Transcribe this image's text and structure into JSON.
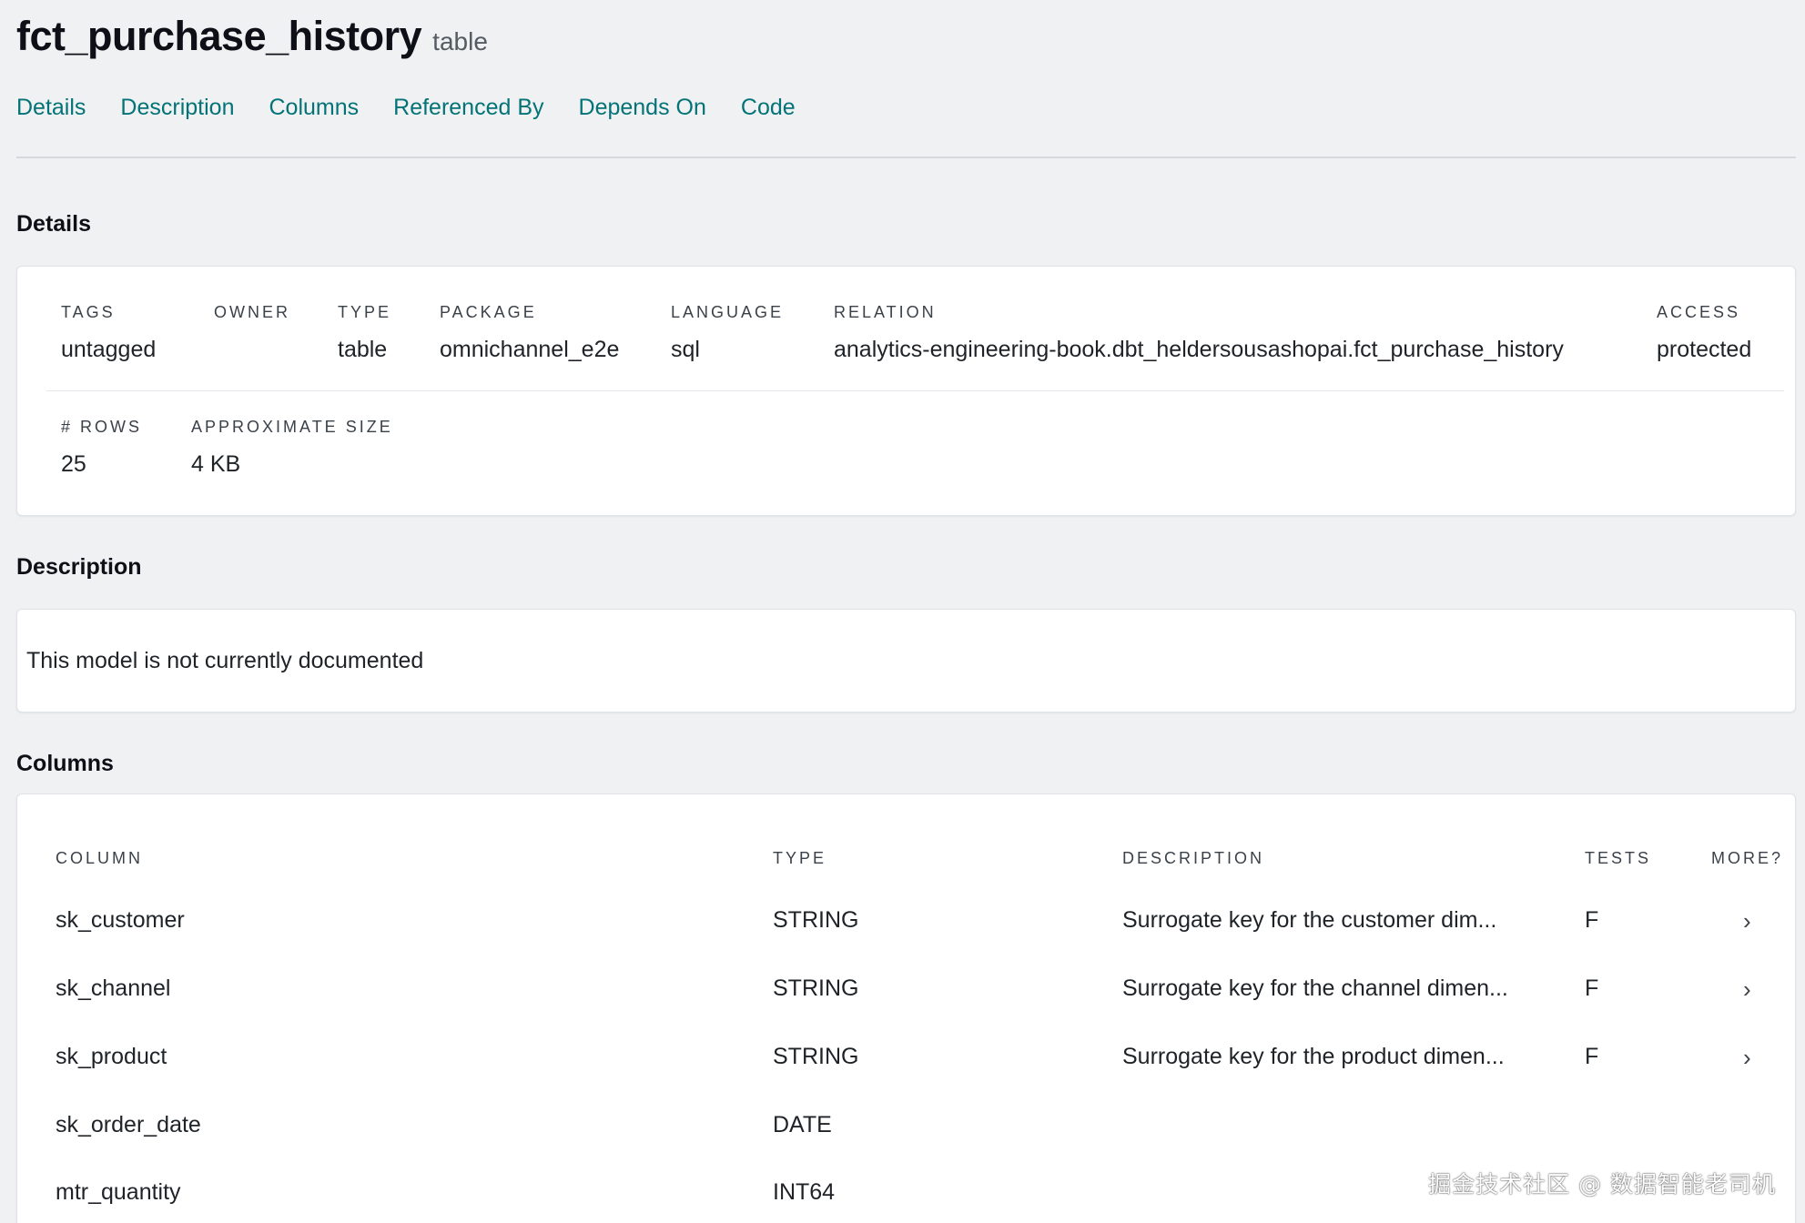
{
  "header": {
    "model_name": "fct_purchase_history",
    "model_kind": "table"
  },
  "tabs": [
    {
      "label": "Details"
    },
    {
      "label": "Description"
    },
    {
      "label": "Columns"
    },
    {
      "label": "Referenced By"
    },
    {
      "label": "Depends On"
    },
    {
      "label": "Code"
    }
  ],
  "details": {
    "heading": "Details",
    "tags": {
      "label": "TAGS",
      "value": "untagged"
    },
    "owner": {
      "label": "OWNER",
      "value": ""
    },
    "type": {
      "label": "TYPE",
      "value": "table"
    },
    "package": {
      "label": "PACKAGE",
      "value": "omnichannel_e2e"
    },
    "language": {
      "label": "LANGUAGE",
      "value": "sql"
    },
    "relation": {
      "label": "RELATION",
      "value": "analytics-engineering-book.dbt_heldersousashopai.fct_purchase_history"
    },
    "access": {
      "label": "ACCESS",
      "value": "protected"
    },
    "rows": {
      "label": "# ROWS",
      "value": "25"
    },
    "size": {
      "label": "APPROXIMATE SIZE",
      "value": "4 KB"
    }
  },
  "description": {
    "heading": "Description",
    "text": "This model is not currently documented"
  },
  "columns": {
    "heading": "Columns",
    "headers": {
      "column": "COLUMN",
      "type": "TYPE",
      "description": "DESCRIPTION",
      "tests": "TESTS",
      "more": "MORE?"
    },
    "rows": [
      {
        "name": "sk_customer",
        "type": "STRING",
        "description": "Surrogate key for the customer dim...",
        "tests": "F",
        "more": "›"
      },
      {
        "name": "sk_channel",
        "type": "STRING",
        "description": "Surrogate key for the channel dimen...",
        "tests": "F",
        "more": "›"
      },
      {
        "name": "sk_product",
        "type": "STRING",
        "description": "Surrogate key for the product dimen...",
        "tests": "F",
        "more": "›"
      },
      {
        "name": "sk_order_date",
        "type": "DATE",
        "description": "",
        "tests": "",
        "more": ""
      },
      {
        "name": "mtr_quantity",
        "type": "INT64",
        "description": "",
        "tests": "",
        "more": ""
      }
    ]
  },
  "watermark": "掘金技术社区 @ 数据智能老司机",
  "colors": {
    "accent_link": "#047377",
    "background": "#f0f1f3"
  }
}
